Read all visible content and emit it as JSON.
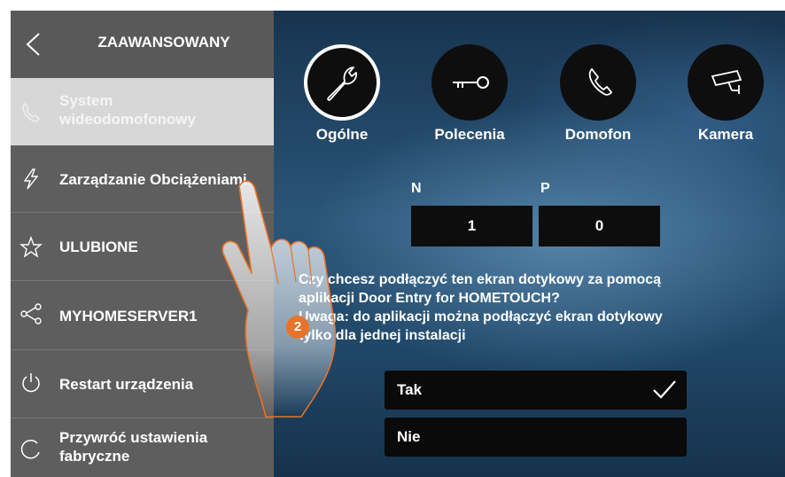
{
  "sidebar": {
    "title": "ZAAWANSOWANY",
    "items": [
      {
        "label_line1": "System",
        "label_line2": "wideodomofonowy",
        "icon": "phone-icon",
        "active": true
      },
      {
        "label": "Zarządzanie Obciążeniami",
        "icon": "lightning-icon"
      },
      {
        "label": "ULUBIONE",
        "icon": "star-icon"
      },
      {
        "label": "MYHOMESERVER1",
        "icon": "share-icon"
      },
      {
        "label": "Restart urządzenia",
        "icon": "power-icon"
      },
      {
        "label_line1": "Przywróć ustawienia",
        "label_line2": "fabryczne",
        "icon": "reset-icon"
      }
    ]
  },
  "categories": [
    {
      "label": "Ogólne",
      "icon": "wrench-icon",
      "selected": true
    },
    {
      "label": "Polecenia",
      "icon": "key-icon"
    },
    {
      "label": "Domofon",
      "icon": "phone-icon"
    },
    {
      "label": "Kamera",
      "icon": "camera-icon"
    }
  ],
  "fields": {
    "n_label": "N",
    "p_label": "P",
    "n_value": "1",
    "p_value": "0"
  },
  "question": {
    "line1": "Czy chcesz podłączyć ten ekran dotykowy za pomocą",
    "line2": "aplikacji Door Entry for HOMETOUCH?",
    "line3": "Uwaga: do aplikacji można podłączyć ekran dotykowy",
    "line4": "tylko dla jednej instalacji"
  },
  "options": [
    {
      "label": "Tak",
      "checked": true
    },
    {
      "label": "Nie",
      "checked": false
    }
  ],
  "annotation": {
    "step": "2",
    "color": "#e8732a"
  }
}
